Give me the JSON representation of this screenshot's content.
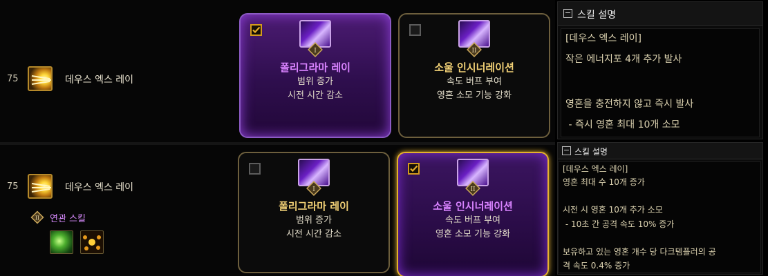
{
  "colors": {
    "accent_purple": "#d983ff",
    "accent_gold": "#f2d176",
    "checkbox_gold": "#d49b1c"
  },
  "rows": [
    {
      "skill": {
        "level": "75",
        "name": "데우스 엑스 레이",
        "icon": "deus-ex-ray-skill-icon"
      },
      "options": [
        {
          "title": "폴리그라마 레이",
          "desc1": "범위 증가",
          "desc2": "시전 시간 감소",
          "checked": true,
          "badge": "I"
        },
        {
          "title": "소울 인시너레이션",
          "desc1": "속도 버프 부여",
          "desc2": "영혼 소모 기능 강화",
          "checked": false,
          "badge": "II"
        }
      ],
      "description": {
        "header": "스킬 설명",
        "collapse_symbol": "−",
        "lines": [
          "[데우스 엑스 레이]",
          "작은 에너지포 4개 추가 발사",
          "",
          "영혼을 충전하지 않고 즉시 발사",
          " - 즉시 영혼 최대 10개 소모"
        ]
      }
    },
    {
      "skill": {
        "level": "75",
        "name": "데우스 엑스 레이",
        "icon": "deus-ex-ray-skill-icon"
      },
      "related": {
        "badge": "II",
        "label": "연관 스킬",
        "icons": [
          "green-claw-skill-icon",
          "golden-orb-skill-icon"
        ]
      },
      "options": [
        {
          "title": "폴리그라마 레이",
          "desc1": "범위 증가",
          "desc2": "시전 시간 감소",
          "checked": false,
          "badge": "I"
        },
        {
          "title": "소울 인시너레이션",
          "desc1": "속도 버프 부여",
          "desc2": "영혼 소모 기능 강화",
          "checked": true,
          "badge": "II"
        }
      ],
      "description": {
        "header": "스킬 설명",
        "collapse_symbol": "−",
        "lines": [
          "[데우스 엑스 레이]",
          "영혼 최대 수 10개 증가",
          "",
          "시전 시 영혼 10개 추가 소모",
          " - 10초 간 공격 속도 10% 증가",
          "",
          "보유하고 있는 영혼 개수 당 다크템플러의 공",
          "격 속도 0.4% 증가"
        ]
      }
    }
  ]
}
